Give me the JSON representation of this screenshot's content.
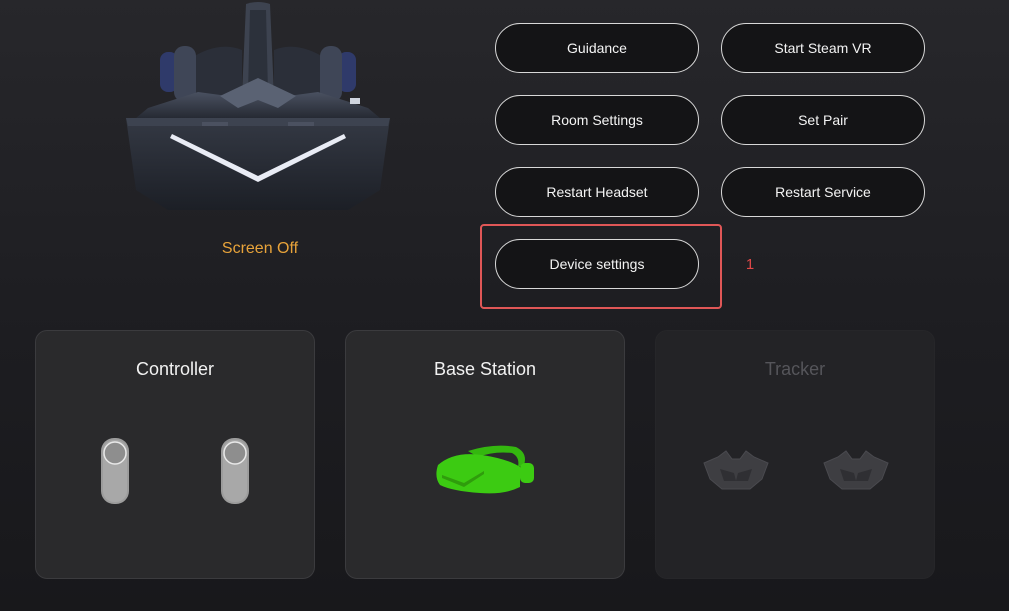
{
  "headset": {
    "status": "Screen Off",
    "status_color": "#e8a33a"
  },
  "buttons": {
    "guidance": "Guidance",
    "start_steam_vr": "Start Steam VR",
    "room_settings": "Room Settings",
    "set_pair": "Set Pair",
    "restart_headset": "Restart Headset",
    "restart_service": "Restart Service",
    "device_settings": "Device settings"
  },
  "annotation": {
    "marker_label": "1",
    "color": "#e05757"
  },
  "devices": [
    {
      "title": "Controller",
      "icon": "controller-icon",
      "state": "active"
    },
    {
      "title": "Base Station",
      "icon": "headset-green-icon",
      "state": "active",
      "icon_color": "#3ccb12"
    },
    {
      "title": "Tracker",
      "icon": "tracker-icon",
      "state": "disabled"
    }
  ]
}
